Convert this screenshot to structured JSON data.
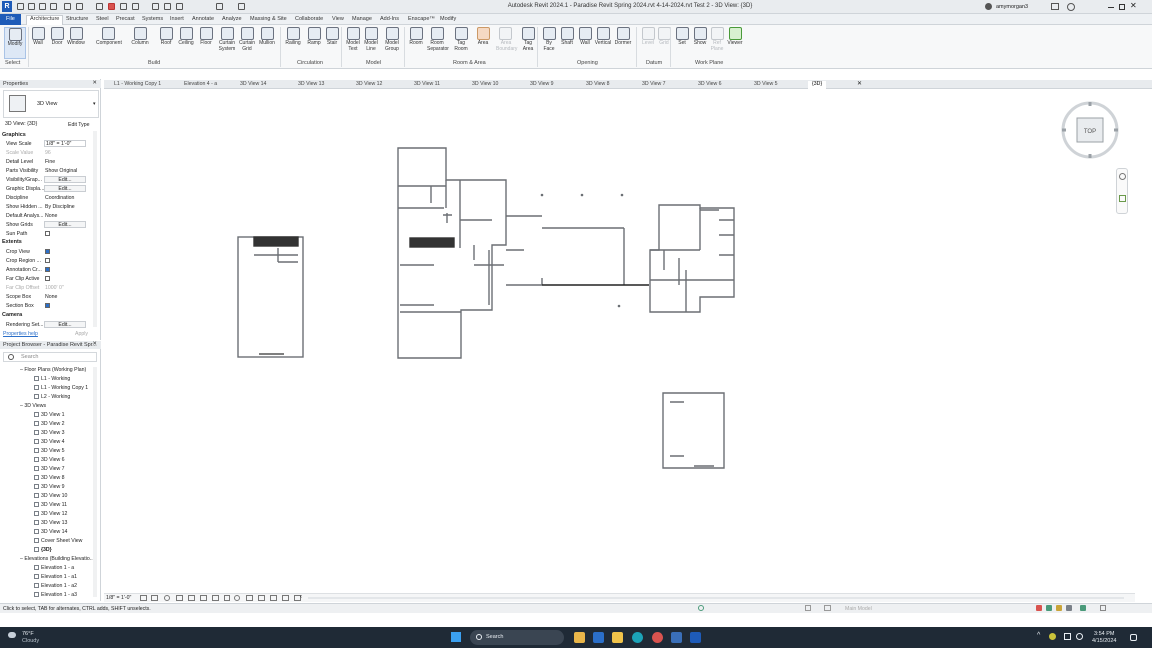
{
  "app": {
    "title": "Autodesk Revit 2024.1 - Paradise Revit Spring 2024.rvt 4-14-2024.rvt Test 2 - 3D View: {3D}",
    "user": "amymorgan3"
  },
  "ribbon_tabs": [
    "File",
    "Architecture",
    "Structure",
    "Steel",
    "Precast",
    "Systems",
    "Insert",
    "Annotate",
    "Analyze",
    "Massing & Site",
    "Collaborate",
    "View",
    "Manage",
    "Add-Ins",
    "Enscape™",
    "Modify"
  ],
  "ribbon": {
    "buttons": [
      {
        "label": "Modify",
        "icon": "cursor-icon"
      },
      {
        "label": "Wall",
        "icon": "wall-icon"
      },
      {
        "label": "Door",
        "icon": "door-icon"
      },
      {
        "label": "Window",
        "icon": "window-icon"
      },
      {
        "label": "Component",
        "icon": "component-icon"
      },
      {
        "label": "Column",
        "icon": "column-icon"
      },
      {
        "label": "Roof",
        "icon": "roof-icon"
      },
      {
        "label": "Ceiling",
        "icon": "ceiling-icon"
      },
      {
        "label": "Floor",
        "icon": "floor-icon"
      },
      {
        "label": "Curtain System",
        "icon": "curtain-system-icon"
      },
      {
        "label": "Curtain Grid",
        "icon": "curtain-grid-icon"
      },
      {
        "label": "Mullion",
        "icon": "mullion-icon"
      },
      {
        "label": "Railing",
        "icon": "railing-icon"
      },
      {
        "label": "Ramp",
        "icon": "ramp-icon"
      },
      {
        "label": "Stair",
        "icon": "stair-icon"
      },
      {
        "label": "Model Text",
        "icon": "model-text-icon"
      },
      {
        "label": "Model Line",
        "icon": "model-line-icon"
      },
      {
        "label": "Model Group",
        "icon": "model-group-icon"
      },
      {
        "label": "Room",
        "icon": "room-icon"
      },
      {
        "label": "Room Separator",
        "icon": "room-separator-icon"
      },
      {
        "label": "Tag Room",
        "icon": "tag-room-icon"
      },
      {
        "label": "Area",
        "icon": "area-icon"
      },
      {
        "label": "Area Boundary",
        "icon": "area-boundary-icon"
      },
      {
        "label": "Tag Area",
        "icon": "tag-area-icon"
      },
      {
        "label": "By Face",
        "icon": "by-face-icon"
      },
      {
        "label": "Shaft",
        "icon": "shaft-icon"
      },
      {
        "label": "Wall",
        "icon": "wall-opening-icon"
      },
      {
        "label": "Vertical",
        "icon": "vertical-icon"
      },
      {
        "label": "Dormer",
        "icon": "dormer-icon"
      },
      {
        "label": "Level",
        "icon": "level-icon"
      },
      {
        "label": "Grid",
        "icon": "grid-icon"
      },
      {
        "label": "Set",
        "icon": "set-icon"
      },
      {
        "label": "Show",
        "icon": "show-icon"
      },
      {
        "label": "Ref Plane",
        "icon": "ref-plane-icon"
      },
      {
        "label": "Viewer",
        "icon": "viewer-icon"
      }
    ],
    "panels": [
      "Select",
      "Build",
      "Circulation",
      "Model",
      "Room & Area",
      "Opening",
      "Datum",
      "Work Plane"
    ]
  },
  "view_tabs": [
    "L1 - Working Copy 1",
    "Elevation 4 - a",
    "3D View 14",
    "3D View 13",
    "3D View 12",
    "3D View 11",
    "3D View 10",
    "3D View 9",
    "3D View 8",
    "3D View 7",
    "3D View 6",
    "3D View 5",
    "{3D}"
  ],
  "properties": {
    "header": "Properties",
    "type_name": "3D View",
    "selector": "3D View: {3D}",
    "edit_type": "Edit Type",
    "sections": {
      "graphics": "Graphics",
      "extents": "Extents",
      "camera": "Camera"
    },
    "rows": [
      {
        "k": "View Scale",
        "v": "1/8\" = 1'-0\""
      },
      {
        "k": "Scale Value",
        "v": "96"
      },
      {
        "k": "Detail Level",
        "v": "Fine"
      },
      {
        "k": "Parts Visibility",
        "v": "Show Original"
      },
      {
        "k": "Visibility/Grap...",
        "v": "Edit..."
      },
      {
        "k": "Graphic Displa...",
        "v": "Edit..."
      },
      {
        "k": "Discipline",
        "v": "Coordination"
      },
      {
        "k": "Show Hidden ...",
        "v": "By Discipline"
      },
      {
        "k": "Default Analys...",
        "v": "None"
      },
      {
        "k": "Show Grids",
        "v": "Edit..."
      },
      {
        "k": "Sun Path",
        "v": ""
      },
      {
        "k": "Crop View",
        "v": ""
      },
      {
        "k": "Crop Region ...",
        "v": ""
      },
      {
        "k": "Annotation Cr...",
        "v": ""
      },
      {
        "k": "Far Clip Active",
        "v": ""
      },
      {
        "k": "Far Clip Offset",
        "v": "1000' 0\""
      },
      {
        "k": "Scope Box",
        "v": "None"
      },
      {
        "k": "Section Box",
        "v": ""
      },
      {
        "k": "Rendering Set...",
        "v": "Edit..."
      }
    ],
    "help": "Properties help",
    "apply": "Apply"
  },
  "project_browser": {
    "header": "Project Browser - Paradise Revit Spr...",
    "search_placeholder": "Search",
    "items": [
      {
        "label": "Floor Plans (Working Plan)",
        "level": 1
      },
      {
        "label": "L1 - Working",
        "level": 2
      },
      {
        "label": "L1 - Working Copy 1",
        "level": 2
      },
      {
        "label": "L2 - Working",
        "level": 2
      },
      {
        "label": "3D Views",
        "level": 1
      },
      {
        "label": "3D View 1",
        "level": 2
      },
      {
        "label": "3D View 2",
        "level": 2
      },
      {
        "label": "3D View 3",
        "level": 2
      },
      {
        "label": "3D View 4",
        "level": 2
      },
      {
        "label": "3D View 5",
        "level": 2
      },
      {
        "label": "3D View 6",
        "level": 2
      },
      {
        "label": "3D View 7",
        "level": 2
      },
      {
        "label": "3D View 8",
        "level": 2
      },
      {
        "label": "3D View 9",
        "level": 2
      },
      {
        "label": "3D View 10",
        "level": 2
      },
      {
        "label": "3D View 11",
        "level": 2
      },
      {
        "label": "3D View 12",
        "level": 2
      },
      {
        "label": "3D View 13",
        "level": 2
      },
      {
        "label": "3D View 14",
        "level": 2
      },
      {
        "label": "Cover Sheet View",
        "level": 2
      },
      {
        "label": "{3D}",
        "level": 2
      },
      {
        "label": "Elevations (Building Elevatio...",
        "level": 1
      },
      {
        "label": "Elevation 1 - a",
        "level": 2
      },
      {
        "label": "Elevation 1 - a1",
        "level": 2
      },
      {
        "label": "Elevation 1 - a2",
        "level": 2
      },
      {
        "label": "Elevation 1 - a3",
        "level": 2
      }
    ]
  },
  "viewcube": {
    "face": "TOP"
  },
  "view_control": {
    "scale": "1/8\" = 1'-0\""
  },
  "status": {
    "hint": "Click to select, TAB for alternates, CTRL adds, SHIFT unselects.",
    "model": "Main Model"
  },
  "taskbar": {
    "weather_temp": "76°F",
    "weather_desc": "Cloudy",
    "search_placeholder": "Search",
    "time": "3:54 PM",
    "date": "4/15/2024"
  },
  "colors": {
    "accent": "#2b6fc9",
    "taskbar": "#1f2a36",
    "wall": "#6b6f74"
  }
}
